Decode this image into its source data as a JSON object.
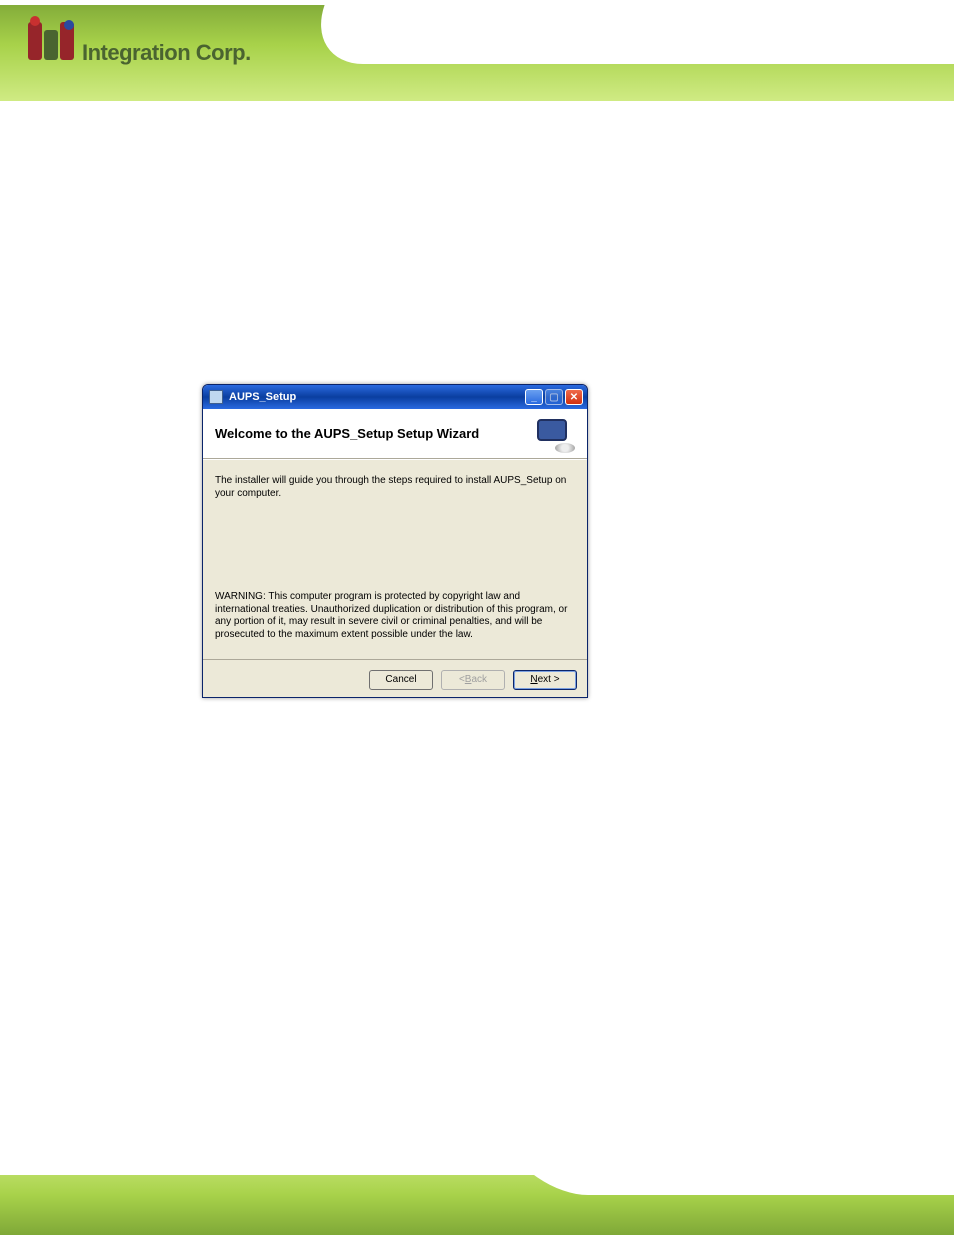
{
  "branding": {
    "company": "Integration Corp.",
    "logo_alt": "iEi"
  },
  "dialog": {
    "window_title": "AUPS_Setup",
    "header_title": "Welcome to the AUPS_Setup Setup Wizard",
    "intro_text": "The installer will guide you through the steps required to install AUPS_Setup on your computer.",
    "warning_text": "WARNING: This computer program is protected by copyright law and international treaties. Unauthorized duplication or distribution of this program, or any portion of it, may result in severe civil or criminal penalties, and will be prosecuted to the maximum extent possible under the law.",
    "buttons": {
      "cancel": "Cancel",
      "back_prefix": "< ",
      "back_u": "B",
      "back_rest": "ack",
      "next_u": "N",
      "next_rest": "ext >"
    },
    "titlebar_icons": {
      "minimize": "minimize-icon",
      "maximize": "maximize-icon",
      "close": "close-icon"
    }
  }
}
